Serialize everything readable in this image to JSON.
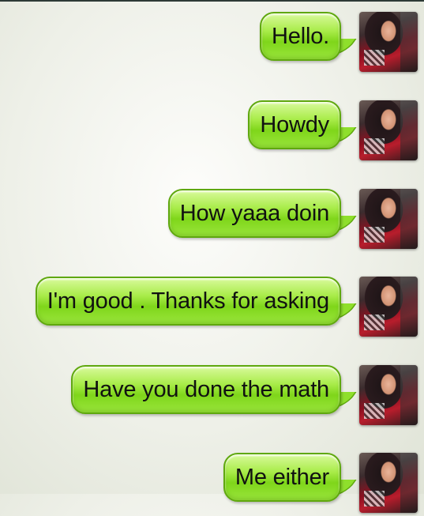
{
  "messages": [
    {
      "text": "Hello."
    },
    {
      "text": "Howdy"
    },
    {
      "text": "How yaaa doin"
    },
    {
      "text": "I'm good . Thanks for asking"
    },
    {
      "text": "Have you done the math"
    },
    {
      "text": "Me either"
    }
  ],
  "colors": {
    "bubble": "#9ae53c",
    "bubble_border": "#5fa80e",
    "background": "#eef0e8"
  }
}
